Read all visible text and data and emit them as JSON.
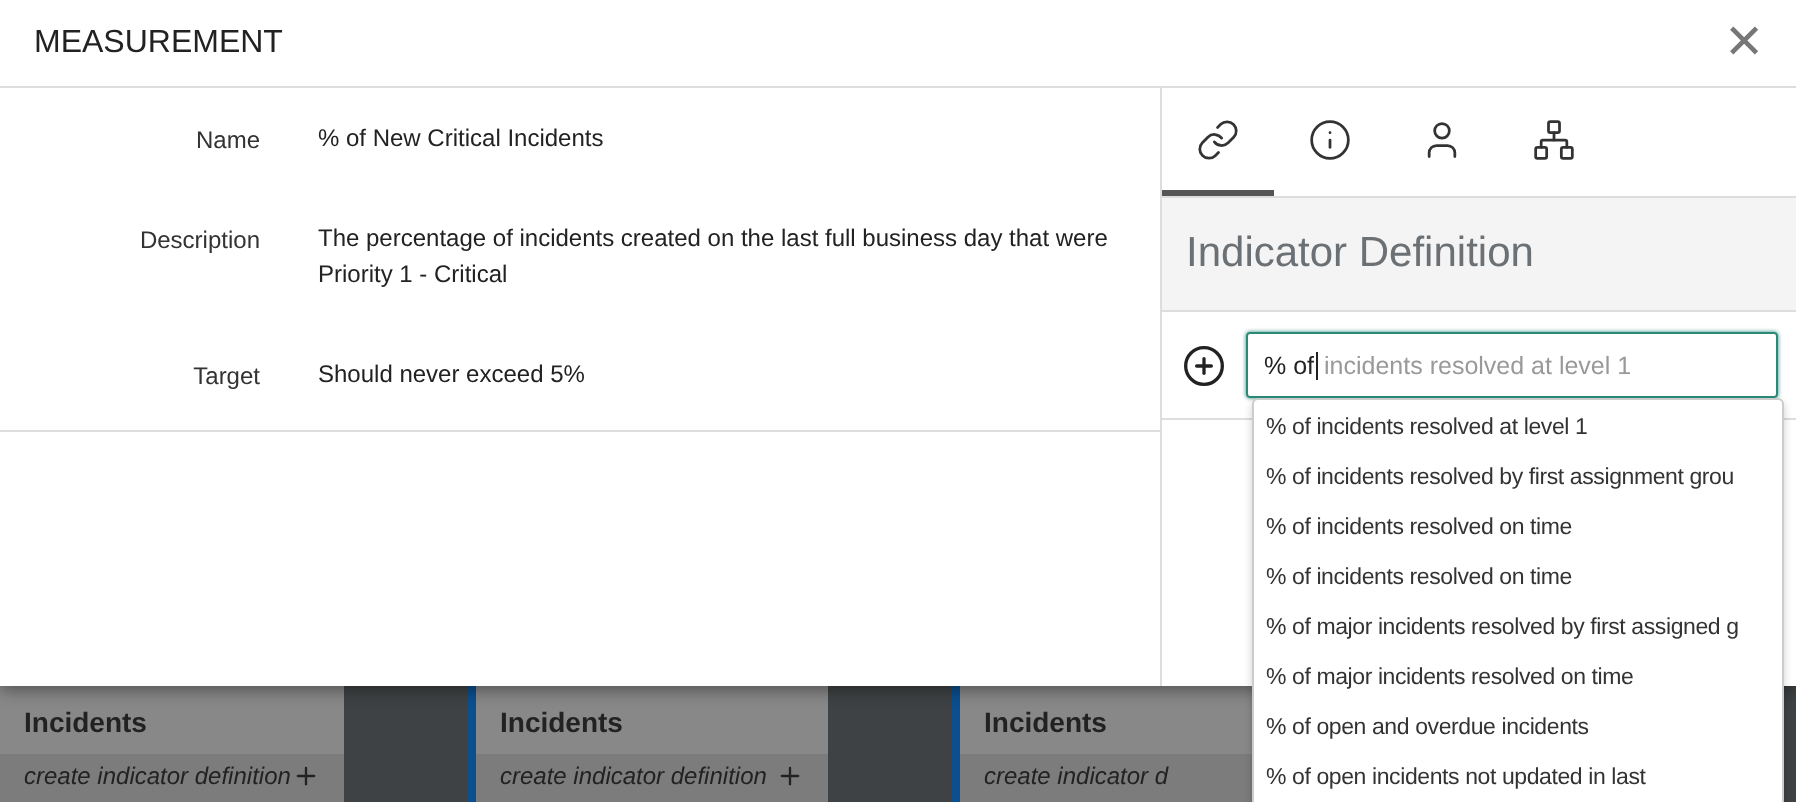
{
  "dialog": {
    "title": "MEASUREMENT",
    "close": "✕"
  },
  "fields": [
    {
      "label": "Name",
      "value": "% of New Critical Incidents"
    },
    {
      "label": "Description",
      "value": "The percentage of incidents created on the last full business day that were Priority 1 - Critical"
    },
    {
      "label": "Target",
      "value": "Should never exceed 5%"
    }
  ],
  "tabs": [
    {
      "kind": "link",
      "selected": true
    },
    {
      "kind": "info",
      "selected": false
    },
    {
      "kind": "user",
      "selected": false
    },
    {
      "kind": "hierarchy",
      "selected": false
    }
  ],
  "panel": {
    "heading": "Indicator Definition"
  },
  "search": {
    "value": "% of",
    "completion": "incidents resolved at level 1"
  },
  "suggestions": [
    "% of incidents resolved at level 1",
    "% of incidents resolved by first assignment grou",
    "% of incidents resolved on time",
    "% of incidents resolved on time",
    "% of major incidents resolved by first assigned g",
    "% of major incidents resolved on time",
    "% of open and overdue incidents",
    "% of open incidents not updated in last"
  ],
  "background_cards": [
    {
      "title": "Incidents",
      "action": "create indicator definition"
    },
    {
      "title": "Incidents",
      "action": "create indicator definition"
    },
    {
      "title": "Incidents",
      "action": "create indicator d"
    }
  ]
}
